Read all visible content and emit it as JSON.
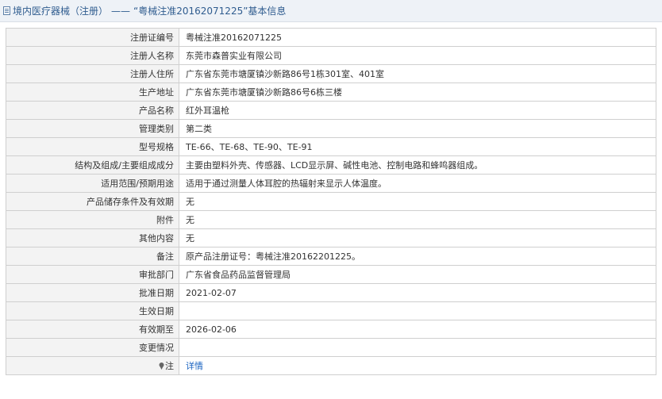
{
  "header": {
    "category": "境内医疗器械（注册）",
    "separator": "——",
    "record_title": "“粤械注准20162071225”基本信息"
  },
  "rows": [
    {
      "label": "注册证编号",
      "value": "粤械注准20162071225"
    },
    {
      "label": "注册人名称",
      "value": "东莞市森普实业有限公司"
    },
    {
      "label": "注册人住所",
      "value": "广东省东莞市塘厦镇沙新路86号1栋301室、401室"
    },
    {
      "label": "生产地址",
      "value": "广东省东莞市塘厦镇沙新路86号6栋三楼"
    },
    {
      "label": "产品名称",
      "value": "红外耳温枪"
    },
    {
      "label": "管理类别",
      "value": "第二类"
    },
    {
      "label": "型号规格",
      "value": "TE-66、TE-68、TE-90、TE-91"
    },
    {
      "label": "结构及组成/主要组成成分",
      "value": "主要由塑料外壳、传感器、LCD显示屏、碱性电池、控制电路和蜂鸣器组成。"
    },
    {
      "label": "适用范围/预期用途",
      "value": "适用于通过测量人体耳腔的热辐射来显示人体温度。"
    },
    {
      "label": "产品储存条件及有效期",
      "value": "无"
    },
    {
      "label": "附件",
      "value": "无"
    },
    {
      "label": "其他内容",
      "value": "无"
    },
    {
      "label": "备注",
      "value": "原产品注册证号：粤械注准20162201225。"
    },
    {
      "label": "审批部门",
      "value": "广东省食品药品监督管理局"
    },
    {
      "label": "批准日期",
      "value": "2021-02-07"
    },
    {
      "label": "生效日期",
      "value": ""
    },
    {
      "label": "有效期至",
      "value": "2026-02-06"
    },
    {
      "label": "变更情况",
      "value": ""
    }
  ],
  "note_row": {
    "label": "注",
    "link": "详情",
    "icon": "pin-icon"
  },
  "colors": {
    "link": "#1a63c1",
    "header_text": "#2f5c8f",
    "label_bg": "#f3f3f3"
  }
}
